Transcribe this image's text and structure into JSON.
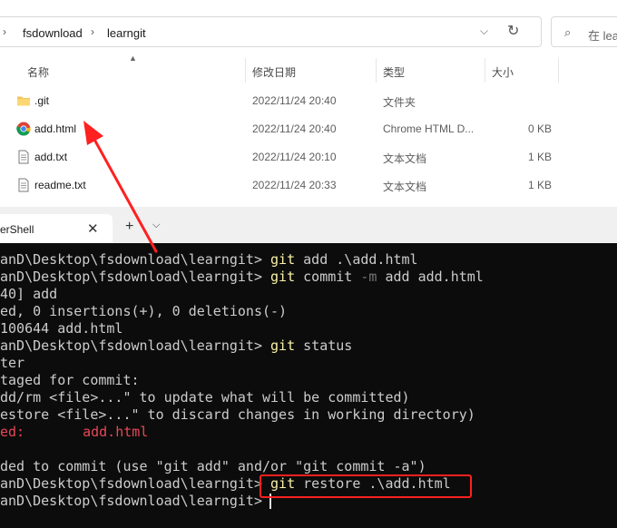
{
  "explorer": {
    "breadcrumb": [
      "fsdownload",
      "learngit"
    ],
    "search_placeholder": "在 lea",
    "columns": {
      "name": "名称",
      "date": "修改日期",
      "type": "类型",
      "size": "大小"
    },
    "files": [
      {
        "icon": "folder-icon",
        "name": ".git",
        "date": "2022/11/24 20:40",
        "type": "文件夹",
        "size": ""
      },
      {
        "icon": "chrome-icon",
        "name": "add.html",
        "date": "2022/11/24 20:40",
        "type": "Chrome HTML D...",
        "size": "0 KB"
      },
      {
        "icon": "text-file-icon",
        "name": "add.txt",
        "date": "2022/11/24 20:10",
        "type": "文本文档",
        "size": "1 KB"
      },
      {
        "icon": "text-file-icon",
        "name": "readme.txt",
        "date": "2022/11/24 20:33",
        "type": "文本文档",
        "size": "1 KB"
      }
    ]
  },
  "terminal": {
    "tab_title": "erShell",
    "new_tab": "+",
    "lines": [
      {
        "prompt": "anD\\Desktop\\fsdownload\\learngit> ",
        "cmd": "git",
        "rest": " add .\\add.html"
      },
      {
        "prompt": "anD\\Desktop\\fsdownload\\learngit> ",
        "cmd": "git",
        "rest": " commit ",
        "flag": "-m",
        "rest2": " add add.html"
      },
      {
        "text": "40] add"
      },
      {
        "text": "ed, 0 insertions(+), 0 deletions(-)"
      },
      {
        "text": "100644 add.html"
      },
      {
        "prompt": "anD\\Desktop\\fsdownload\\learngit> ",
        "cmd": "git",
        "rest": " status"
      },
      {
        "text": "ter"
      },
      {
        "text": "taged for commit:"
      },
      {
        "text": "dd/rm <file>...\" to update what will be committed)"
      },
      {
        "text": "estore <file>...\" to discard changes in working directory)"
      },
      {
        "red_label": "ed:",
        "red_file": "add.html"
      },
      {
        "text": ""
      },
      {
        "text": "ded to commit (use \"git add\" and/or \"git commit -a\")"
      },
      {
        "prompt": "anD\\Desktop\\fsdownload\\learngit> ",
        "cmd": "git",
        "rest": " restore .\\add.html"
      },
      {
        "prompt": "anD\\Desktop\\fsdownload\\learngit> ",
        "text": ""
      }
    ]
  },
  "annotation_color": "#ff2020"
}
